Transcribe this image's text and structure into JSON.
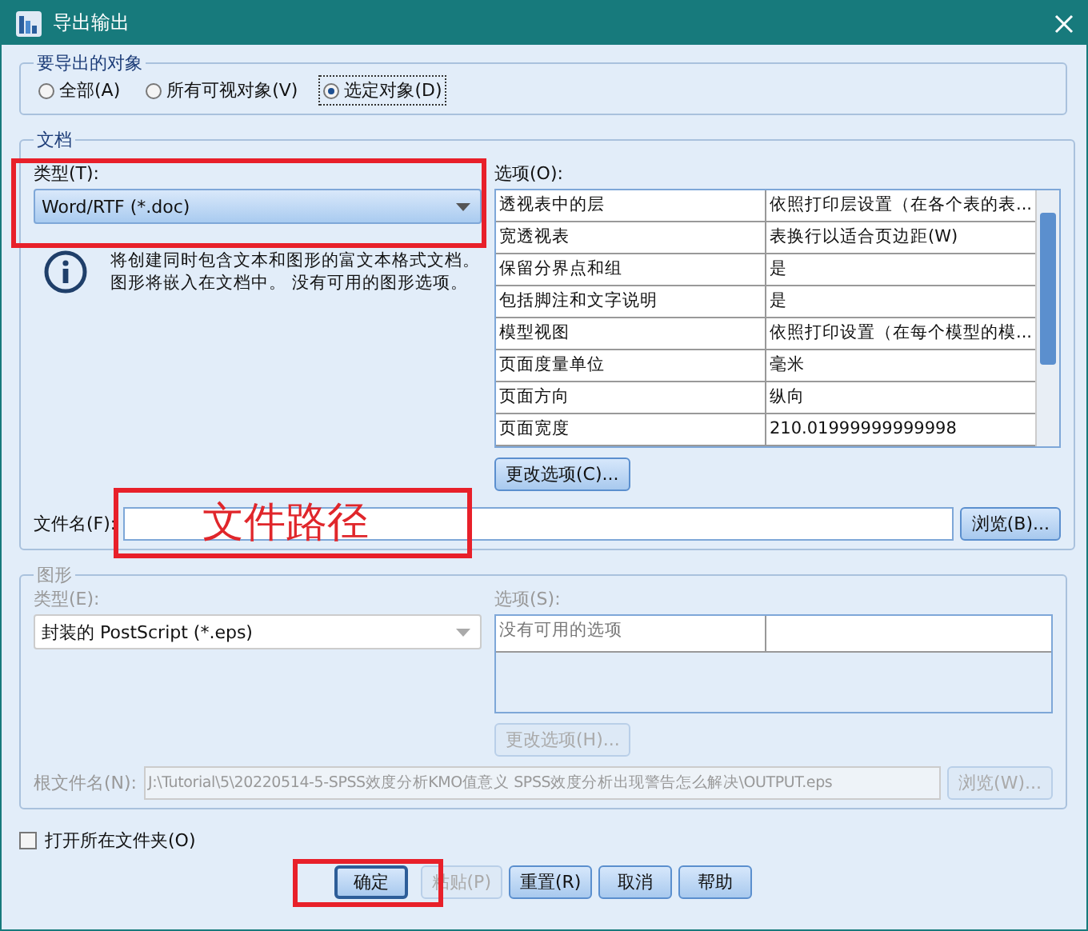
{
  "window": {
    "title": "导出输出"
  },
  "export_objects": {
    "legend": "要导出的对象",
    "options": [
      {
        "label": "全部(A)",
        "selected": false
      },
      {
        "label": "所有可视对象(V)",
        "selected": false
      },
      {
        "label": "选定对象(D)",
        "selected": true
      }
    ]
  },
  "document": {
    "legend": "文档",
    "type_label": "类型(T):",
    "type_value": "Word/RTF (*.doc)",
    "info": [
      "将创建同时包含文本和图形的富文本格式文档。",
      "图形将嵌入在文档中。 没有可用的图形选项。"
    ],
    "options_label": "选项(O):",
    "options": [
      {
        "name": "透视表中的层",
        "value": "依照打印层设置（在各个表的表..."
      },
      {
        "name": "宽透视表",
        "value": "表换行以适合页边距(W)"
      },
      {
        "name": "保留分界点和组",
        "value": "是"
      },
      {
        "name": "包括脚注和文字说明",
        "value": "是"
      },
      {
        "name": "模型视图",
        "value": "依照打印设置（在每个模型的模..."
      },
      {
        "name": "页面度量单位",
        "value": "毫米"
      },
      {
        "name": "页面方向",
        "value": "纵向"
      },
      {
        "name": "页面宽度",
        "value": "210.01999999999998"
      }
    ],
    "change_button": "更改选项(C)...",
    "file_label": "文件名(F):",
    "browse_button": "浏览(B)..."
  },
  "graphics": {
    "legend": "图形",
    "disabled": true,
    "type_label": "类型(E):",
    "type_value": "封装的 PostScript (*.eps)",
    "options_label": "选项(S):",
    "options": [
      {
        "name": "没有可用的选项"
      }
    ],
    "change_button": "更改选项(H)...",
    "file_label": "根文件名(N):",
    "file_value": "J:\\Tutorial\\5\\20220514-5-SPSS效度分析KMO值意义 SPSS效度分析出现警告怎么解决\\OUTPUT.eps",
    "browse_button": "浏览(W)..."
  },
  "open_folder": {
    "label": "打开所在文件夹(O)",
    "checked": false
  },
  "buttons": [
    {
      "label": "确定",
      "disabled": false,
      "default": true
    },
    {
      "label": "粘贴(P)",
      "disabled": true,
      "default": false
    },
    {
      "label": "重置(R)",
      "disabled": false,
      "default": false
    },
    {
      "label": "取消",
      "disabled": false,
      "default": false
    },
    {
      "label": "帮助",
      "disabled": false,
      "default": false
    }
  ],
  "annotation": {
    "text": "文件路径"
  }
}
